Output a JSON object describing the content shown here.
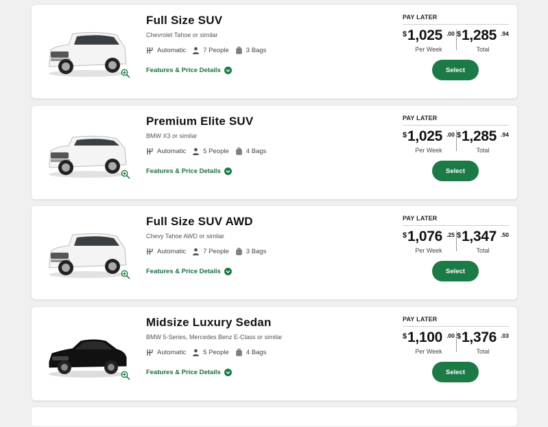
{
  "colors": {
    "accent": "#1b7a45",
    "accent_text": "#1b6e3f",
    "background": "#f0f0f0"
  },
  "cars": [
    {
      "title": "Full Size SUV",
      "subtitle": "Chevrolet Tahoe or similar",
      "transmission": "Automatic",
      "people": "7 People",
      "bags": "3 Bags",
      "features": "Features & Price Details",
      "pay_label": "PAY LATER",
      "week_currency": "$",
      "week_amount": "1,025",
      "week_cents": ".00",
      "week_caption": "Per Week",
      "total_currency": "$",
      "total_amount": "1,285",
      "total_cents": ".94",
      "total_caption": "Total",
      "select": "Select",
      "car_color": "white",
      "car_type": "suv"
    },
    {
      "title": "Premium Elite SUV",
      "subtitle": "BMW X3 or similar",
      "transmission": "Automatic",
      "people": "5 People",
      "bags": "4 Bags",
      "features": "Features & Price Details",
      "pay_label": "PAY LATER",
      "week_currency": "$",
      "week_amount": "1,025",
      "week_cents": ".00",
      "week_caption": "Per Week",
      "total_currency": "$",
      "total_amount": "1,285",
      "total_cents": ".94",
      "total_caption": "Total",
      "select": "Select",
      "car_color": "white",
      "car_type": "crossover"
    },
    {
      "title": "Full Size SUV AWD",
      "subtitle": "Chevy Tahoe AWD or similar",
      "transmission": "Automatic",
      "people": "7 People",
      "bags": "3 Bags",
      "features": "Features & Price Details",
      "pay_label": "PAY LATER",
      "week_currency": "$",
      "week_amount": "1,076",
      "week_cents": ".25",
      "week_caption": "Per Week",
      "total_currency": "$",
      "total_amount": "1,347",
      "total_cents": ".50",
      "total_caption": "Total",
      "select": "Select",
      "car_color": "white",
      "car_type": "suv"
    },
    {
      "title": "Midsize Luxury Sedan",
      "subtitle": "BMW 5-Series, Mercedes Benz E-Class or similar",
      "transmission": "Automatic",
      "people": "5 People",
      "bags": "4 Bags",
      "features": "Features & Price Details",
      "pay_label": "PAY LATER",
      "week_currency": "$",
      "week_amount": "1,100",
      "week_cents": ".00",
      "week_caption": "Per Week",
      "total_currency": "$",
      "total_amount": "1,376",
      "total_cents": ".03",
      "total_caption": "Total",
      "select": "Select",
      "car_color": "black",
      "car_type": "sedan"
    }
  ]
}
